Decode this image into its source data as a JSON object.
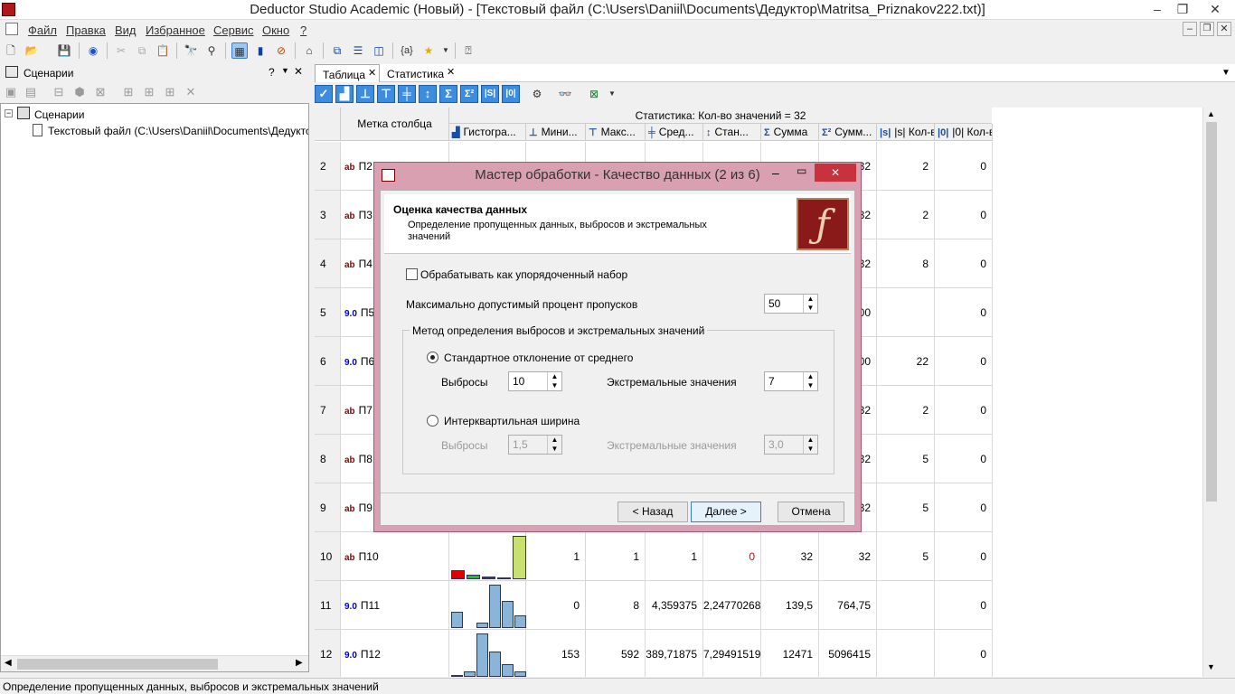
{
  "window": {
    "title": "Deductor Studio Academic (Новый) - [Текстовый файл (C:\\Users\\Daniil\\Documents\\Дедуктор\\Matritsa_Priznakov222.txt)]"
  },
  "menu": [
    "Файл",
    "Правка",
    "Вид",
    "Избранное",
    "Сервис",
    "Окно",
    "?"
  ],
  "scenarios": {
    "title": "Сценарии",
    "help": "?",
    "tree_root": "Сценарии",
    "tree_item": "Текстовый файл (C:\\Users\\Daniil\\Documents\\Дедуктор\\M"
  },
  "tabs": [
    {
      "label": "Таблица"
    },
    {
      "label": "Статистика"
    }
  ],
  "grid": {
    "column_label_header": "Метка столбца",
    "stats_header": "Статистика: Кол-во значений = 32",
    "columns": [
      "Гистогра...",
      "Мини...",
      "Макс...",
      "Сред...",
      "Стан...",
      "Сумма",
      "Сумм...",
      "|s| Кол-в...",
      "|0| Кол-в..."
    ],
    "rows": [
      {
        "n": "2",
        "type": "ab",
        "name": "П2",
        "min": "",
        "max": "",
        "mean": "",
        "std": "",
        "sum": "",
        "sumsq": "32",
        "cnt": "2",
        "cnt0": "0"
      },
      {
        "n": "3",
        "type": "ab",
        "name": "П3",
        "min": "",
        "max": "",
        "mean": "",
        "std": "",
        "sum": "",
        "sumsq": "32",
        "cnt": "2",
        "cnt0": "0"
      },
      {
        "n": "4",
        "type": "ab",
        "name": "П4",
        "min": "",
        "max": "",
        "mean": "",
        "std": "",
        "sum": "",
        "sumsq": "32",
        "cnt": "8",
        "cnt0": "0"
      },
      {
        "n": "5",
        "type": "9.0",
        "name": "П5",
        "min": "",
        "max": "",
        "mean": "",
        "std": "",
        "sum": "",
        "sumsq": "00",
        "cnt": "",
        "cnt0": "0"
      },
      {
        "n": "6",
        "type": "9.0",
        "name": "П6",
        "min": "",
        "max": "",
        "mean": "",
        "std": "",
        "sum": "",
        "sumsq": "00",
        "cnt": "22",
        "cnt0": "0"
      },
      {
        "n": "7",
        "type": "ab",
        "name": "П7",
        "min": "",
        "max": "",
        "mean": "",
        "std": "",
        "sum": "",
        "sumsq": "32",
        "cnt": "2",
        "cnt0": "0"
      },
      {
        "n": "8",
        "type": "ab",
        "name": "П8",
        "min": "",
        "max": "",
        "mean": "",
        "std": "",
        "sum": "",
        "sumsq": "32",
        "cnt": "5",
        "cnt0": "0"
      },
      {
        "n": "9",
        "type": "ab",
        "name": "П9",
        "min": "",
        "max": "",
        "mean": "",
        "std": "",
        "sum": "",
        "sumsq": "32",
        "cnt": "5",
        "cnt0": "0"
      },
      {
        "n": "10",
        "type": "ab",
        "name": "П10",
        "min": "1",
        "max": "1",
        "mean": "1",
        "std": "0",
        "sum": "32",
        "sumsq": "32",
        "cnt": "5",
        "cnt0": "0"
      },
      {
        "n": "11",
        "type": "9.0",
        "name": "П11",
        "min": "0",
        "max": "8",
        "mean": "4,359375",
        "std": "2,24770268",
        "sum": "139,5",
        "sumsq": "764,75",
        "cnt": "",
        "cnt0": "0"
      },
      {
        "n": "12",
        "type": "9.0",
        "name": "П12",
        "min": "153",
        "max": "592",
        "mean": "389,71875",
        "std": "7,29491519",
        "sum": "12471",
        "sumsq": "5096415",
        "cnt": "",
        "cnt0": "0"
      }
    ]
  },
  "dialog": {
    "title": "Мастер обработки - Качество данных (2 из 6)",
    "heading": "Оценка качества данных",
    "subheading": "Определение пропущенных данных, выбросов и экстремальных значений",
    "ordered_checkbox": "Обрабатывать как упорядоченный набор",
    "max_missing_label": "Максимально допустимый процент пропусков",
    "max_missing_value": "50",
    "group_title": "Метод определения выбросов и экстремальных значений",
    "method_std": "Стандартное отклонение от среднего",
    "outliers_label": "Выбросы",
    "outliers_std_value": "10",
    "extreme_label": "Экстремальные значения",
    "extreme_std_value": "7",
    "method_iqr": "Интерквартильная ширина",
    "outliers_iqr_value": "1,5",
    "extreme_iqr_value": "3,0",
    "back_button": "< Назад",
    "next_button": "Далее >",
    "cancel_button": "Отмена"
  },
  "status": {
    "text": "Определение пропущенных данных, выбросов и экстремальных значений"
  }
}
